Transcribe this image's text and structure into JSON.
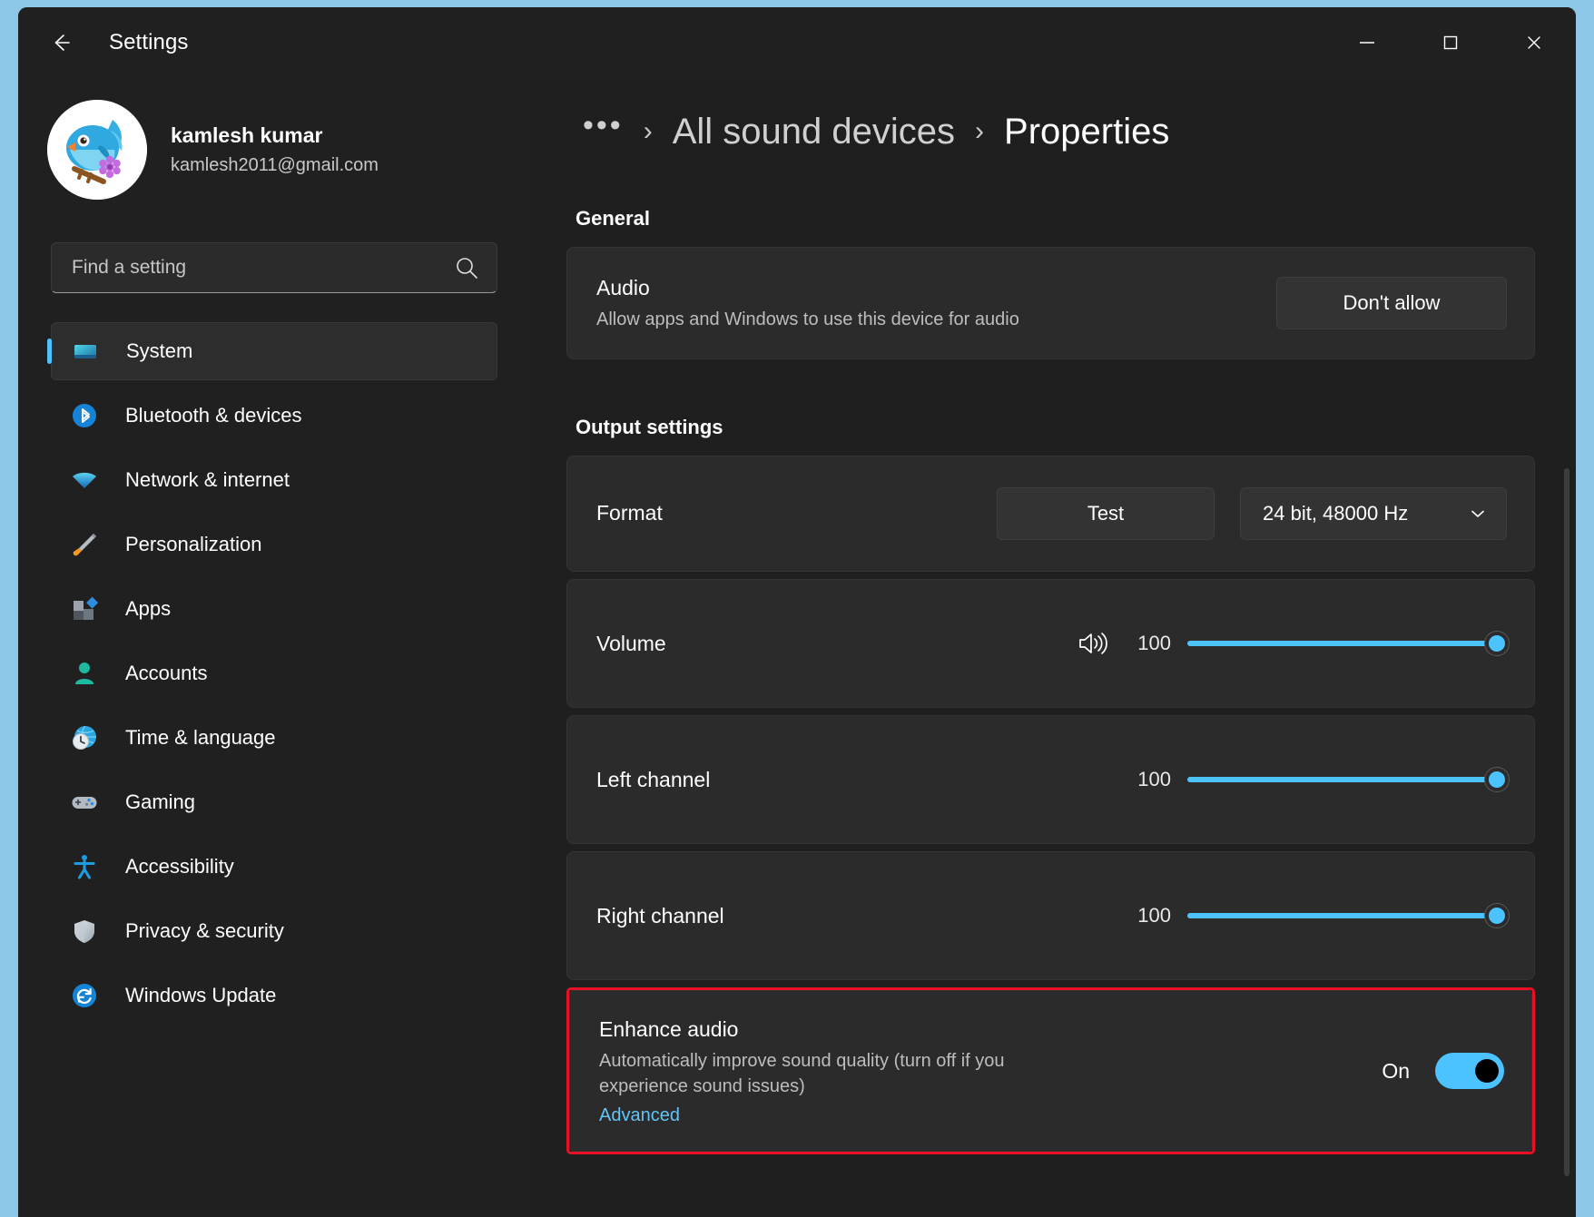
{
  "window": {
    "app_title": "Settings",
    "back_icon": "back-arrow-icon",
    "minimize_label": "—",
    "maximize_label": "□",
    "close_label": "✕"
  },
  "profile": {
    "name": "kamlesh kumar",
    "email": "kamlesh2011@gmail.com"
  },
  "search": {
    "placeholder": "Find a setting",
    "value": ""
  },
  "sidebar": {
    "items": [
      {
        "label": "System",
        "icon": "monitor-icon",
        "active": true
      },
      {
        "label": "Bluetooth & devices",
        "icon": "bluetooth-icon",
        "active": false
      },
      {
        "label": "Network & internet",
        "icon": "wifi-icon",
        "active": false
      },
      {
        "label": "Personalization",
        "icon": "paintbrush-icon",
        "active": false
      },
      {
        "label": "Apps",
        "icon": "apps-icon",
        "active": false
      },
      {
        "label": "Accounts",
        "icon": "person-icon",
        "active": false
      },
      {
        "label": "Time & language",
        "icon": "clock-globe-icon",
        "active": false
      },
      {
        "label": "Gaming",
        "icon": "gamepad-icon",
        "active": false
      },
      {
        "label": "Accessibility",
        "icon": "accessibility-icon",
        "active": false
      },
      {
        "label": "Privacy & security",
        "icon": "shield-icon",
        "active": false
      },
      {
        "label": "Windows Update",
        "icon": "refresh-icon",
        "active": false
      }
    ]
  },
  "breadcrumb": {
    "overflow": "•••",
    "separator": "›",
    "parent": "All sound devices",
    "current": "Properties"
  },
  "general": {
    "heading": "General",
    "audio": {
      "title": "Audio",
      "subtitle": "Allow apps and Windows to use this device for audio",
      "button_label": "Don't allow"
    }
  },
  "output_settings": {
    "heading": "Output settings",
    "format": {
      "label": "Format",
      "test_button": "Test",
      "selected": "24 bit, 48000 Hz",
      "chevron": "⌄"
    },
    "volume": {
      "label": "Volume",
      "value": "100",
      "icon": "speaker-icon"
    },
    "left_channel": {
      "label": "Left channel",
      "value": "100"
    },
    "right_channel": {
      "label": "Right channel",
      "value": "100"
    },
    "enhance_audio": {
      "title": "Enhance audio",
      "subtitle": "Automatically improve sound quality (turn off if you experience sound issues)",
      "link": "Advanced",
      "toggle_state": "On"
    }
  },
  "colors": {
    "accent": "#4cc2ff",
    "highlight_border": "#e81123",
    "link": "#62c4f5",
    "window_bg": "#1f1f1f",
    "card_bg": "#2b2b2b"
  }
}
